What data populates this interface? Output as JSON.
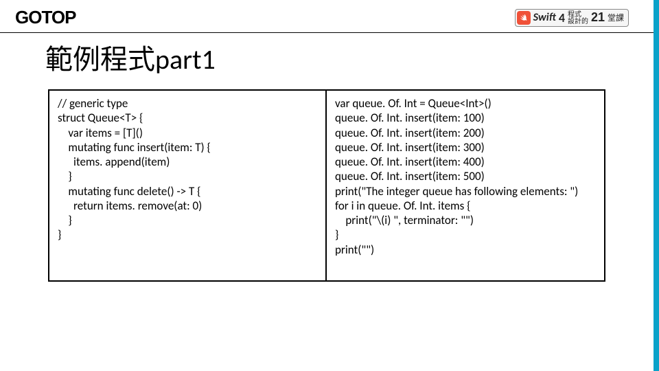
{
  "header": {
    "logo": "GOTOP",
    "badge": {
      "swift_text": "Swift",
      "swift_version": "4",
      "cn_top": "程式",
      "cn_bottom": "設計的",
      "big": "21",
      "course": "堂課"
    }
  },
  "title": "範例程式part1",
  "code_left": "// generic type\nstruct Queue<T> {\n    var items = [T]()\n    mutating func insert(item: T) {\n      items. append(item)\n    }\n    mutating func delete() -> T {\n      return items. remove(at: 0)\n    }\n}",
  "code_right": "var queue. Of. Int = Queue<Int>()\nqueue. Of. Int. insert(item: 100)\nqueue. Of. Int. insert(item: 200)\nqueue. Of. Int. insert(item: 300)\nqueue. Of. Int. insert(item: 400)\nqueue. Of. Int. insert(item: 500)\nprint(\"The integer queue has following elements: \")\nfor i in queue. Of. Int. items {\n    print(\"\\(i) \", terminator: \"\")\n}\nprint(\"\")"
}
